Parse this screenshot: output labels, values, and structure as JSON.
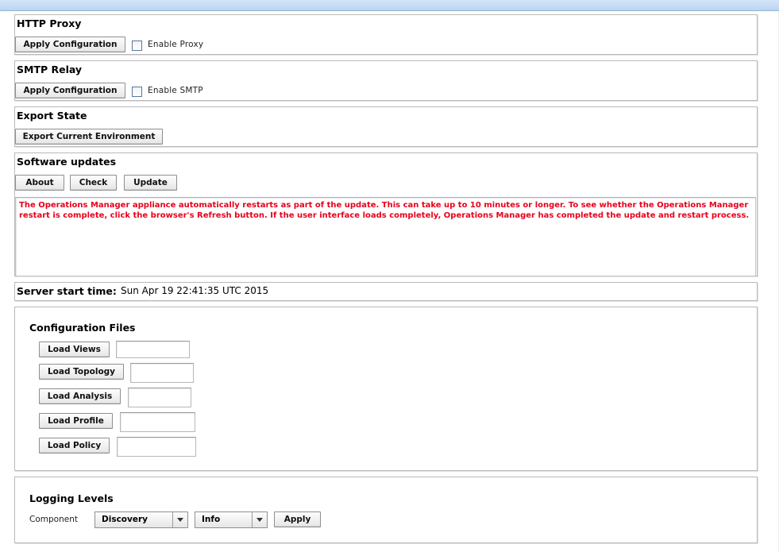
{
  "http_proxy": {
    "title": "HTTP Proxy",
    "apply_label": "Apply Configuration",
    "enable_label": "Enable Proxy"
  },
  "smtp_relay": {
    "title": "SMTP Relay",
    "apply_label": "Apply Configuration",
    "enable_label": "Enable SMTP"
  },
  "export_state": {
    "title": "Export State",
    "export_label": "Export Current Environment"
  },
  "software_updates": {
    "title": "Software updates",
    "about_label": "About",
    "check_label": "Check",
    "update_label": "Update",
    "message": "The Operations Manager appliance automatically restarts as part of the update. This can take up to 10 minutes or longer. To see whether the Operations Manager restart is complete, click the browser's Refresh button. If the user interface loads completely, Operations Manager has completed the update and restart process."
  },
  "server_start": {
    "label": "Server start time:",
    "value": "Sun Apr 19 22:41:35 UTC 2015"
  },
  "config_files": {
    "title": "Configuration Files",
    "load_views": "Load Views",
    "load_topology": "Load Topology",
    "load_analysis": "Load Analysis",
    "load_profile": "Load Profile",
    "load_policy": "Load Policy"
  },
  "logging": {
    "title": "Logging Levels",
    "component_label": "Component",
    "component_value": "Discovery",
    "level_value": "Info",
    "apply_label": "Apply"
  },
  "colors": {
    "warning_text": "#e8001c",
    "topbar": "#c6dbf5"
  }
}
